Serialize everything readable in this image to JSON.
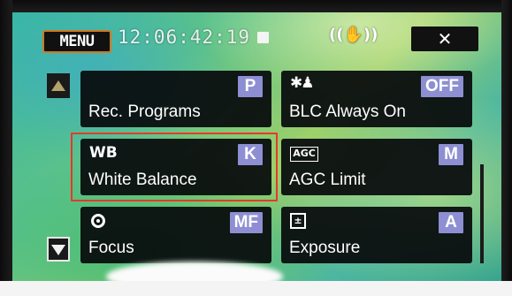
{
  "header": {
    "menu_label": "MENU",
    "timecode": "12:06:42:19",
    "stop_icon": "stop-square-icon",
    "stabilizer_icon": "image-stabilizer-icon",
    "stabilizer_glyph": "((✋))",
    "close_glyph": "✕"
  },
  "tiles": {
    "rec_programs": {
      "label": "Rec. Programs",
      "badge": "P"
    },
    "blc": {
      "label": "BLC Always On",
      "badge": "OFF",
      "icon_glyph": "✱♟"
    },
    "white_balance": {
      "label": "White Balance",
      "badge": "K",
      "icon_text": "WB"
    },
    "agc": {
      "label": "AGC Limit",
      "badge": "M",
      "icon_text": "AGC"
    },
    "focus": {
      "label": "Focus",
      "badge": "MF"
    },
    "exposure": {
      "label": "Exposure",
      "badge": "A",
      "icon_text": "±"
    }
  },
  "colors": {
    "badge": "#8d8fd2",
    "selection_frame": "#e8382a",
    "menu_border": "#d07820"
  }
}
